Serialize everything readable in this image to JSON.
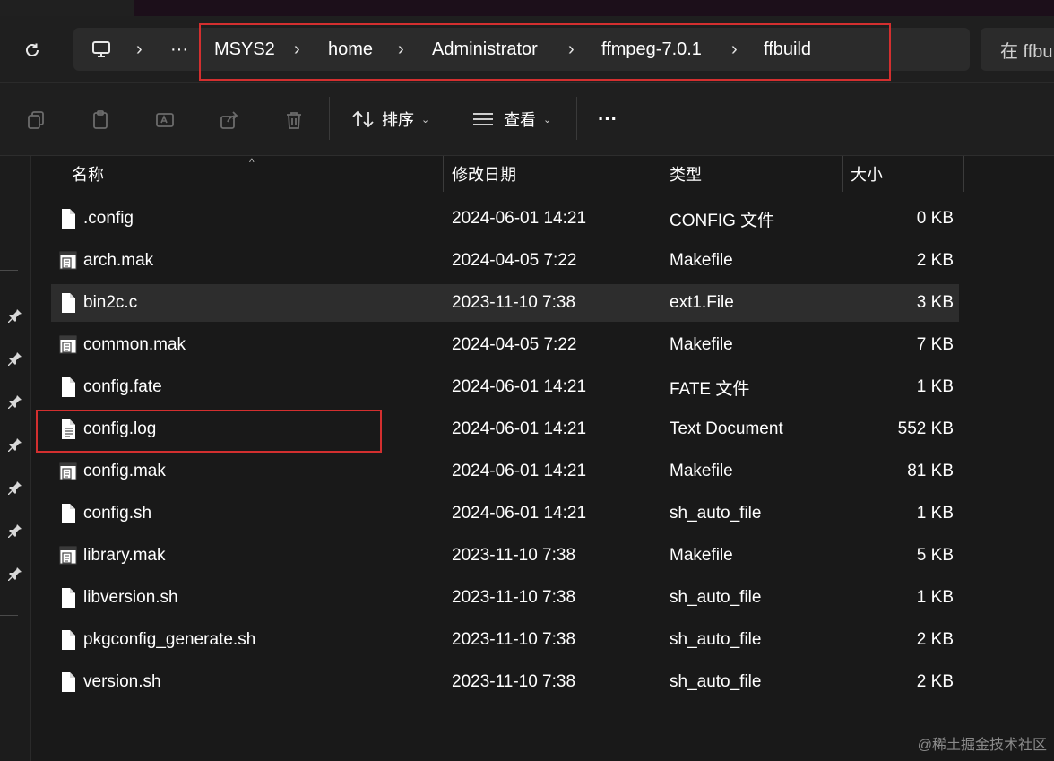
{
  "breadcrumb": {
    "items": [
      "MSYS2",
      "home",
      "Administrator",
      "ffmpeg-7.0.1",
      "ffbuild"
    ],
    "more": "···"
  },
  "search": {
    "placeholder": "在 ffbu"
  },
  "toolbar": {
    "sort_label": "排序",
    "view_label": "查看",
    "more_label": "···"
  },
  "columns": {
    "name": "名称",
    "date": "修改日期",
    "type": "类型",
    "size": "大小"
  },
  "files": [
    {
      "name": ".config",
      "date": "2024-06-01 14:21",
      "type": "CONFIG 文件",
      "size": "0 KB",
      "icon": "file-icon"
    },
    {
      "name": "arch.mak",
      "date": "2024-04-05 7:22",
      "type": "Makefile",
      "size": "2 KB",
      "icon": "makefile-icon"
    },
    {
      "name": "bin2c.c",
      "date": "2023-11-10 7:38",
      "type": "ext1.File",
      "size": "3 KB",
      "icon": "file-icon"
    },
    {
      "name": "common.mak",
      "date": "2024-04-05 7:22",
      "type": "Makefile",
      "size": "7 KB",
      "icon": "makefile-icon"
    },
    {
      "name": "config.fate",
      "date": "2024-06-01 14:21",
      "type": "FATE 文件",
      "size": "1 KB",
      "icon": "file-icon"
    },
    {
      "name": "config.log",
      "date": "2024-06-01 14:21",
      "type": "Text Document",
      "size": "552 KB",
      "icon": "text-document-icon"
    },
    {
      "name": "config.mak",
      "date": "2024-06-01 14:21",
      "type": "Makefile",
      "size": "81 KB",
      "icon": "makefile-icon"
    },
    {
      "name": "config.sh",
      "date": "2024-06-01 14:21",
      "type": "sh_auto_file",
      "size": "1 KB",
      "icon": "file-icon"
    },
    {
      "name": "library.mak",
      "date": "2023-11-10 7:38",
      "type": "Makefile",
      "size": "5 KB",
      "icon": "makefile-icon"
    },
    {
      "name": "libversion.sh",
      "date": "2023-11-10 7:38",
      "type": "sh_auto_file",
      "size": "1 KB",
      "icon": "file-icon"
    },
    {
      "name": "pkgconfig_generate.sh",
      "date": "2023-11-10 7:38",
      "type": "sh_auto_file",
      "size": "2 KB",
      "icon": "file-icon"
    },
    {
      "name": "version.sh",
      "date": "2023-11-10 7:38",
      "type": "sh_auto_file",
      "size": "2 KB",
      "icon": "file-icon"
    }
  ],
  "watermark": "@稀土掘金技术社区",
  "colors": {
    "highlight": "#d32f2f",
    "selected_row": "#2d2d2d",
    "background": "#191919"
  }
}
